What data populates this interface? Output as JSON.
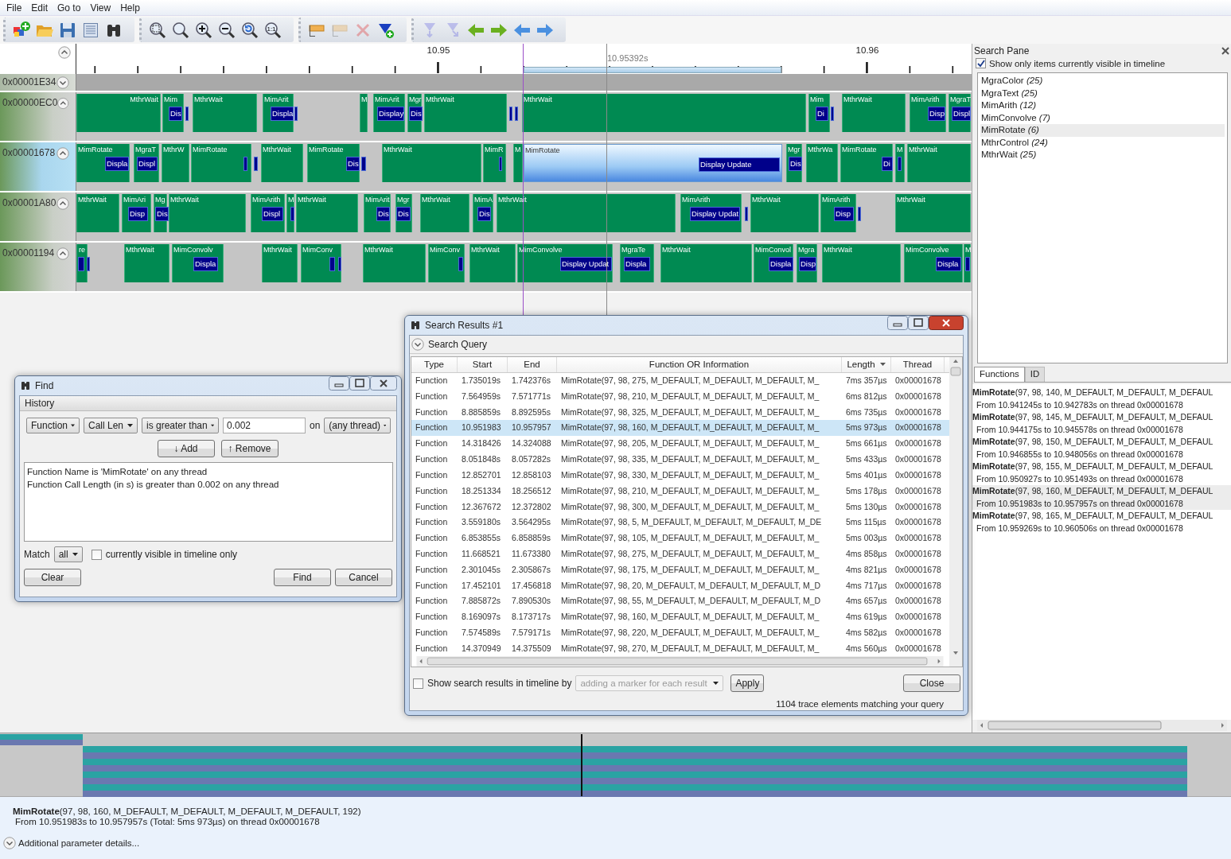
{
  "menu": [
    "File",
    "Edit",
    "Go to",
    "View",
    "Help"
  ],
  "toolbar": [
    {
      "items": [
        {
          "kind": "new",
          "disabled": false
        },
        {
          "kind": "open",
          "disabled": false
        },
        {
          "kind": "save",
          "disabled": false
        },
        {
          "kind": "list",
          "disabled": false
        },
        {
          "kind": "find",
          "disabled": false
        }
      ]
    },
    {
      "items": [
        {
          "kind": "zoom-select",
          "disabled": false
        },
        {
          "kind": "zoom",
          "disabled": false
        },
        {
          "kind": "zoom-in",
          "disabled": false
        },
        {
          "kind": "zoom-out",
          "disabled": false
        },
        {
          "kind": "zoom-undo",
          "disabled": false
        },
        {
          "kind": "zoom-actual",
          "text": "1:1",
          "disabled": false
        }
      ]
    },
    {
      "items": [
        {
          "kind": "marker",
          "disabled": false
        },
        {
          "kind": "marker",
          "disabled": true
        },
        {
          "kind": "delete",
          "disabled": true
        },
        {
          "kind": "funnel-add",
          "disabled": false
        }
      ]
    },
    {
      "items": [
        {
          "kind": "filter-prev",
          "disabled": true
        },
        {
          "kind": "filter-next",
          "disabled": true
        },
        {
          "kind": "back",
          "disabled": false
        },
        {
          "kind": "forward",
          "disabled": false
        },
        {
          "kind": "back-blue",
          "disabled": false
        },
        {
          "kind": "forward-blue",
          "disabled": false
        }
      ]
    }
  ],
  "timeline": {
    "ruler": {
      "labels": [
        "10.95",
        "10.96"
      ],
      "cursor": "10.95392s"
    },
    "threads": [
      {
        "id": "0x00001E34",
        "expanded": false,
        "selected": false
      },
      {
        "id": "0x00000EC0",
        "expanded": true,
        "selected": false,
        "calls": [
          {
            "name": "MthrWait",
            "selected": false
          },
          {
            "name": "Mim",
            "child": "Dis",
            "selected": false
          },
          {
            "name": "MthrWait",
            "selected": false
          },
          {
            "name": "MimArit",
            "child": "Displa",
            "selected": false
          },
          {
            "name": "M",
            "selected": false
          },
          {
            "name": "MimArit",
            "child": "Display",
            "selected": false
          },
          {
            "name": "Mgr",
            "child": "Dis",
            "selected": false
          },
          {
            "name": "MthrWait",
            "selected": false
          },
          {
            "name": "MthrWait",
            "selected": false
          },
          {
            "name": "Mim",
            "child": "Di",
            "selected": false
          },
          {
            "name": "MthrWait",
            "selected": false
          },
          {
            "name": "MimArith",
            "child": "Disp",
            "selected": false
          },
          {
            "name": "MgraT",
            "child": "Displ",
            "selected": false
          }
        ]
      },
      {
        "id": "0x00001678",
        "expanded": true,
        "selected": true,
        "calls": [
          {
            "name": "MimRotate",
            "child": "Displa",
            "selected": false
          },
          {
            "name": "MgraT",
            "child": "Displ",
            "selected": false
          },
          {
            "name": "MthrW",
            "selected": false
          },
          {
            "name": "MimRotate",
            "selected": false
          },
          {
            "name": "MthrWait",
            "selected": false
          },
          {
            "name": "MimRotate",
            "child": "Dis",
            "selected": false
          },
          {
            "name": "MthrWait",
            "selected": false
          },
          {
            "name": "MimR",
            "selected": false
          },
          {
            "name": "M",
            "selected": false
          },
          {
            "name": "MimRotate",
            "child": "Display Update",
            "selected": true
          },
          {
            "name": "Mgr",
            "child": "Dis",
            "selected": false
          },
          {
            "name": "MthrWa",
            "selected": false
          },
          {
            "name": "MimRotate",
            "child": "Di",
            "selected": false
          },
          {
            "name": "M",
            "selected": false
          },
          {
            "name": "MthrWait",
            "selected": false
          }
        ]
      },
      {
        "id": "0x00001A80",
        "expanded": true,
        "selected": false,
        "calls": [
          {
            "name": "MthrWait",
            "selected": false
          },
          {
            "name": "MimAri",
            "child": "Disp",
            "selected": false
          },
          {
            "name": "Mg",
            "child": "Dis",
            "selected": false
          },
          {
            "name": "MthrWait",
            "selected": false
          },
          {
            "name": "MimArith",
            "child": "Displ",
            "selected": false
          },
          {
            "name": "M",
            "selected": false
          },
          {
            "name": "MthrWait",
            "selected": false
          },
          {
            "name": "MimArit",
            "child": "Dis",
            "selected": false
          },
          {
            "name": "Mgr",
            "child": "Dis",
            "selected": false
          },
          {
            "name": "MthrWait",
            "selected": false
          },
          {
            "name": "MimA",
            "child": "Dis",
            "selected": false
          },
          {
            "name": "MthrWait",
            "selected": false
          },
          {
            "name": "MimArith",
            "child": "Display Updat",
            "selected": false
          },
          {
            "name": "MthrWait",
            "selected": false
          },
          {
            "name": "MimArith",
            "child": "Disp",
            "selected": false
          },
          {
            "name": "MthrWait",
            "selected": false
          }
        ]
      },
      {
        "id": "0x00001194",
        "expanded": true,
        "selected": false,
        "calls": [
          {
            "name": "re",
            "selected": false
          },
          {
            "name": "MthrWait",
            "selected": false
          },
          {
            "name": "MimConvolv",
            "child": "Displa",
            "selected": false
          },
          {
            "name": "MthrWait",
            "selected": false
          },
          {
            "name": "MimConv",
            "selected": false
          },
          {
            "name": "MthrWait",
            "selected": false
          },
          {
            "name": "MimConv",
            "selected": false
          },
          {
            "name": "MthrWait",
            "selected": false
          },
          {
            "name": "MimConvolve",
            "child": "Display Updat",
            "selected": false
          },
          {
            "name": "MgraTe",
            "child": "Displa",
            "selected": false
          },
          {
            "name": "MthrWait",
            "selected": false
          },
          {
            "name": "MimConvol",
            "child": "Displa",
            "selected": false
          },
          {
            "name": "Mgra",
            "child": "Disp",
            "selected": false
          },
          {
            "name": "MthrWait",
            "selected": false
          },
          {
            "name": "MimConvolve",
            "child": "Displa",
            "selected": false
          },
          {
            "name": "M",
            "selected": false
          }
        ]
      }
    ]
  },
  "search_pane": {
    "title": "Search Pane",
    "only_visible": {
      "label": "Show only items currently visible in timeline",
      "checked": true
    },
    "functions": [
      {
        "label": "MgraColor *(25)*",
        "selected": false
      },
      {
        "label": "MgraText *(25)*",
        "selected": false
      },
      {
        "label": "MimArith *(12)*",
        "selected": false
      },
      {
        "label": "MimConvolve *(7)*",
        "selected": false
      },
      {
        "label": "MimRotate *(6)*",
        "selected": true
      },
      {
        "label": "MthrControl *(24)*",
        "selected": false
      },
      {
        "label": "MthrWait *(25)*",
        "selected": false
      }
    ],
    "tabs": [
      {
        "label": "Functions",
        "selected": true
      },
      {
        "label": "ID",
        "selected": false
      }
    ],
    "results": [
      {
        "heading": "**MimRotate**(97, 98, 140, M_DEFAULT, M_DEFAULT, M_DEFAUL",
        "detail": "From 10.941245s to 10.942783s on thread 0x00001678",
        "selected": false
      },
      {
        "heading": "**MimRotate**(97, 98, 145, M_DEFAULT, M_DEFAULT, M_DEFAUL",
        "detail": "From 10.944175s to 10.945578s on thread 0x00001678",
        "selected": false
      },
      {
        "heading": "**MimRotate**(97, 98, 150, M_DEFAULT, M_DEFAULT, M_DEFAUL",
        "detail": "From 10.946855s to 10.948056s on thread 0x00001678",
        "selected": false
      },
      {
        "heading": "**MimRotate**(97, 98, 155, M_DEFAULT, M_DEFAULT, M_DEFAUL",
        "detail": "From 10.950927s to 10.951493s on thread 0x00001678",
        "selected": false
      },
      {
        "heading": "**MimRotate**(97, 98, 160, M_DEFAULT, M_DEFAULT, M_DEFAUL",
        "detail": "From 10.951983s to 10.957957s on thread 0x00001678",
        "selected": true
      },
      {
        "heading": "**MimRotate**(97, 98, 165, M_DEFAULT, M_DEFAULT, M_DEFAUL",
        "detail": "From 10.959269s to 10.960506s on thread 0x00001678",
        "selected": false
      }
    ]
  },
  "find_dialog": {
    "title": "Find",
    "section": "History",
    "criteria": [
      {
        "kind": "dropdown",
        "value": "Function"
      },
      {
        "kind": "dropdown",
        "value": "Call Len"
      },
      {
        "kind": "dropdown",
        "value": "is greater than"
      },
      {
        "kind": "input",
        "value": "0.002"
      },
      {
        "kind": "label",
        "value": "on"
      },
      {
        "kind": "dropdown",
        "value": "(any thread)"
      }
    ],
    "buttons": [
      "↓ Add",
      "↑ Remove"
    ],
    "query_lines": [
      "Function Name is 'MimRotate' on any thread",
      "Function Call Length (in s) is greater than 0.002 on any thread"
    ],
    "match": {
      "label": "Match",
      "value": "all"
    },
    "visible_only": {
      "label": "currently visible in timeline only",
      "checked": false
    },
    "actions": [
      "Clear",
      "Find",
      "Cancel"
    ]
  },
  "results_window": {
    "title": "Search Results #1",
    "query_label": "Search Query",
    "columns": [
      {
        "label": "Type",
        "sorted": false
      },
      {
        "label": "Start",
        "sorted": false
      },
      {
        "label": "End",
        "sorted": false
      },
      {
        "label": "Function OR Information",
        "sorted": false
      },
      {
        "label": "Length",
        "sorted": true
      },
      {
        "label": "Thread",
        "sorted": false
      }
    ],
    "rows": [
      {
        "type": "Function",
        "start": "1.735019s",
        "end": "1.742376s",
        "function": "MimRotate(97, 98, 275, M_DEFAULT, M_DEFAULT, M_DEFAULT, M_",
        "length": "7ms 357µs",
        "thread": "0x00001678",
        "selected": false
      },
      {
        "type": "Function",
        "start": "7.564959s",
        "end": "7.571771s",
        "function": "MimRotate(97, 98, 210, M_DEFAULT, M_DEFAULT, M_DEFAULT, M_",
        "length": "6ms 812µs",
        "thread": "0x00001678",
        "selected": false
      },
      {
        "type": "Function",
        "start": "8.885859s",
        "end": "8.892595s",
        "function": "MimRotate(97, 98, 325, M_DEFAULT, M_DEFAULT, M_DEFAULT, M_",
        "length": "6ms 735µs",
        "thread": "0x00001678",
        "selected": false
      },
      {
        "type": "Function",
        "start": "10.951983",
        "end": "10.957957",
        "function": "MimRotate(97, 98, 160, M_DEFAULT, M_DEFAULT, M_DEFAULT, M_",
        "length": "5ms 973µs",
        "thread": "0x00001678",
        "selected": true
      },
      {
        "type": "Function",
        "start": "14.318426",
        "end": "14.324088",
        "function": "MimRotate(97, 98, 205, M_DEFAULT, M_DEFAULT, M_DEFAULT, M_",
        "length": "5ms 661µs",
        "thread": "0x00001678",
        "selected": false
      },
      {
        "type": "Function",
        "start": "8.051848s",
        "end": "8.057282s",
        "function": "MimRotate(97, 98, 335, M_DEFAULT, M_DEFAULT, M_DEFAULT, M_",
        "length": "5ms 433µs",
        "thread": "0x00001678",
        "selected": false
      },
      {
        "type": "Function",
        "start": "12.852701",
        "end": "12.858103",
        "function": "MimRotate(97, 98, 330, M_DEFAULT, M_DEFAULT, M_DEFAULT, M_",
        "length": "5ms 401µs",
        "thread": "0x00001678",
        "selected": false
      },
      {
        "type": "Function",
        "start": "18.251334",
        "end": "18.256512",
        "function": "MimRotate(97, 98, 210, M_DEFAULT, M_DEFAULT, M_DEFAULT, M_",
        "length": "5ms 178µs",
        "thread": "0x00001678",
        "selected": false
      },
      {
        "type": "Function",
        "start": "12.367672",
        "end": "12.372802",
        "function": "MimRotate(97, 98, 300, M_DEFAULT, M_DEFAULT, M_DEFAULT, M_",
        "length": "5ms 130µs",
        "thread": "0x00001678",
        "selected": false
      },
      {
        "type": "Function",
        "start": "3.559180s",
        "end": "3.564295s",
        "function": "MimRotate(97, 98, 5, M_DEFAULT, M_DEFAULT, M_DEFAULT, M_DE",
        "length": "5ms 115µs",
        "thread": "0x00001678",
        "selected": false
      },
      {
        "type": "Function",
        "start": "6.853855s",
        "end": "6.858859s",
        "function": "MimRotate(97, 98, 105, M_DEFAULT, M_DEFAULT, M_DEFAULT, M_",
        "length": "5ms 003µs",
        "thread": "0x00001678",
        "selected": false
      },
      {
        "type": "Function",
        "start": "11.668521",
        "end": "11.673380",
        "function": "MimRotate(97, 98, 275, M_DEFAULT, M_DEFAULT, M_DEFAULT, M_",
        "length": "4ms 858µs",
        "thread": "0x00001678",
        "selected": false
      },
      {
        "type": "Function",
        "start": "2.301045s",
        "end": "2.305867s",
        "function": "MimRotate(97, 98, 175, M_DEFAULT, M_DEFAULT, M_DEFAULT, M_",
        "length": "4ms 821µs",
        "thread": "0x00001678",
        "selected": false
      },
      {
        "type": "Function",
        "start": "17.452101",
        "end": "17.456818",
        "function": "MimRotate(97, 98, 20, M_DEFAULT, M_DEFAULT, M_DEFAULT, M_D",
        "length": "4ms 717µs",
        "thread": "0x00001678",
        "selected": false
      },
      {
        "type": "Function",
        "start": "7.885872s",
        "end": "7.890530s",
        "function": "MimRotate(97, 98, 55, M_DEFAULT, M_DEFAULT, M_DEFAULT, M_D",
        "length": "4ms 657µs",
        "thread": "0x00001678",
        "selected": false
      },
      {
        "type": "Function",
        "start": "8.169097s",
        "end": "8.173717s",
        "function": "MimRotate(97, 98, 160, M_DEFAULT, M_DEFAULT, M_DEFAULT, M_",
        "length": "4ms 619µs",
        "thread": "0x00001678",
        "selected": false
      },
      {
        "type": "Function",
        "start": "7.574589s",
        "end": "7.579171s",
        "function": "MimRotate(97, 98, 220, M_DEFAULT, M_DEFAULT, M_DEFAULT, M_",
        "length": "4ms 582µs",
        "thread": "0x00001678",
        "selected": false
      },
      {
        "type": "Function",
        "start": "14.370949",
        "end": "14.375509",
        "function": "MimRotate(97, 98, 270, M_DEFAULT, M_DEFAULT, M_DEFAULT, M_",
        "length": "4ms 560µs",
        "thread": "0x00001678",
        "selected": false
      }
    ],
    "show_in_timeline": {
      "label": "Show search results in timeline by",
      "checked": false
    },
    "marker_mode": {
      "value": "adding a marker for each result",
      "disabled": true
    },
    "apply": "Apply",
    "close": "Close",
    "status": "1104 trace elements matching your query"
  },
  "details": {
    "heading": "**MimRotate**(97, 98, 160, M_DEFAULT, M_DEFAULT, M_DEFAULT, M_DEFAULT, 192)",
    "range": "From 10.951983s to 10.957957s (Total: 5ms 973µs) on thread 0x00001678",
    "expander": "Additional parameter details..."
  }
}
